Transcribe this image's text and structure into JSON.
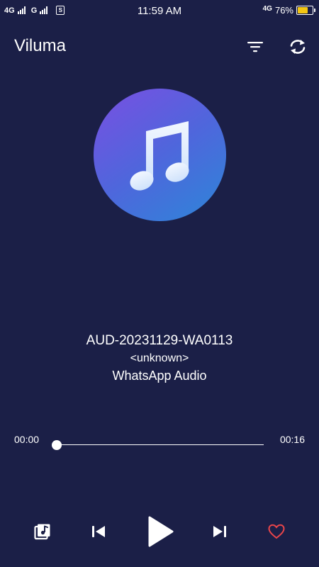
{
  "status_bar": {
    "sim1_network": "4G",
    "sim2_network": "G",
    "time": "11:59 AM",
    "right_network": "4G",
    "battery_percent": "76%",
    "battery_level": 0.76,
    "battery_color": "#f3c613"
  },
  "header": {
    "title": "Viluma",
    "sort_icon": "sort-filter-icon",
    "sync_icon": "refresh-icon"
  },
  "album_art": {
    "icon": "music-note-icon",
    "gradient": [
      "#7a4fe2",
      "#4f66dc",
      "#2d86d8"
    ]
  },
  "track": {
    "title": "AUD-20231129-WA0113",
    "artist": "<unknown>",
    "album": "WhatsApp Audio"
  },
  "progress": {
    "current": "00:00",
    "total": "00:16",
    "fraction": 0.0
  },
  "controls": {
    "playlist_icon": "playlist-icon",
    "prev_icon": "skip-previous-icon",
    "play_icon": "play-icon",
    "next_icon": "skip-next-icon",
    "favorite_icon": "heart-outline-icon",
    "favorite_color": "#e8454a"
  },
  "colors": {
    "background": "#1b1f47",
    "text": "#ffffff"
  }
}
